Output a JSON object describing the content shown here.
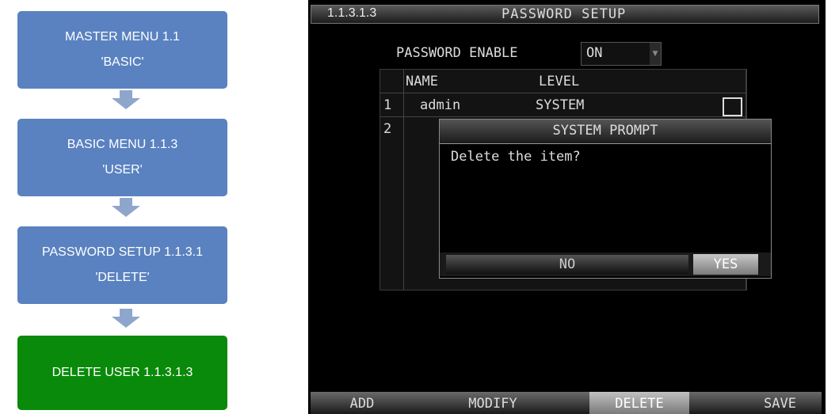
{
  "flow": {
    "box1": {
      "line1": "MASTER MENU 1.1",
      "line2": "'BASIC'"
    },
    "box2": {
      "line1": "BASIC MENU 1.1.3",
      "line2": "'USER'"
    },
    "box3": {
      "line1": "PASSWORD SETUP 1.1.3.1",
      "line2": "'DELETE'"
    },
    "box4": {
      "line1": "DELETE USER 1.1.3.1.3"
    }
  },
  "dvr": {
    "menu_id": "1.1.3.1.3",
    "title": "PASSWORD SETUP",
    "password_enable": {
      "label": "PASSWORD ENABLE",
      "value": "ON"
    },
    "table": {
      "headers": {
        "name": "NAME",
        "level": "LEVEL"
      },
      "rows": [
        {
          "num": "1",
          "name": "admin",
          "level": "SYSTEM"
        },
        {
          "num": "2"
        }
      ]
    },
    "prompt": {
      "title": "SYSTEM PROMPT",
      "message": "Delete the item?",
      "no": "NO",
      "yes": "YES"
    },
    "bottom": {
      "add": "ADD",
      "modify": "MODIFY",
      "delete": "DELETE",
      "save": "SAVE"
    }
  },
  "colors": {
    "flow_blue": "#5a82c0",
    "flow_green": "#0a8a0a",
    "screen_bg": "#000000"
  }
}
